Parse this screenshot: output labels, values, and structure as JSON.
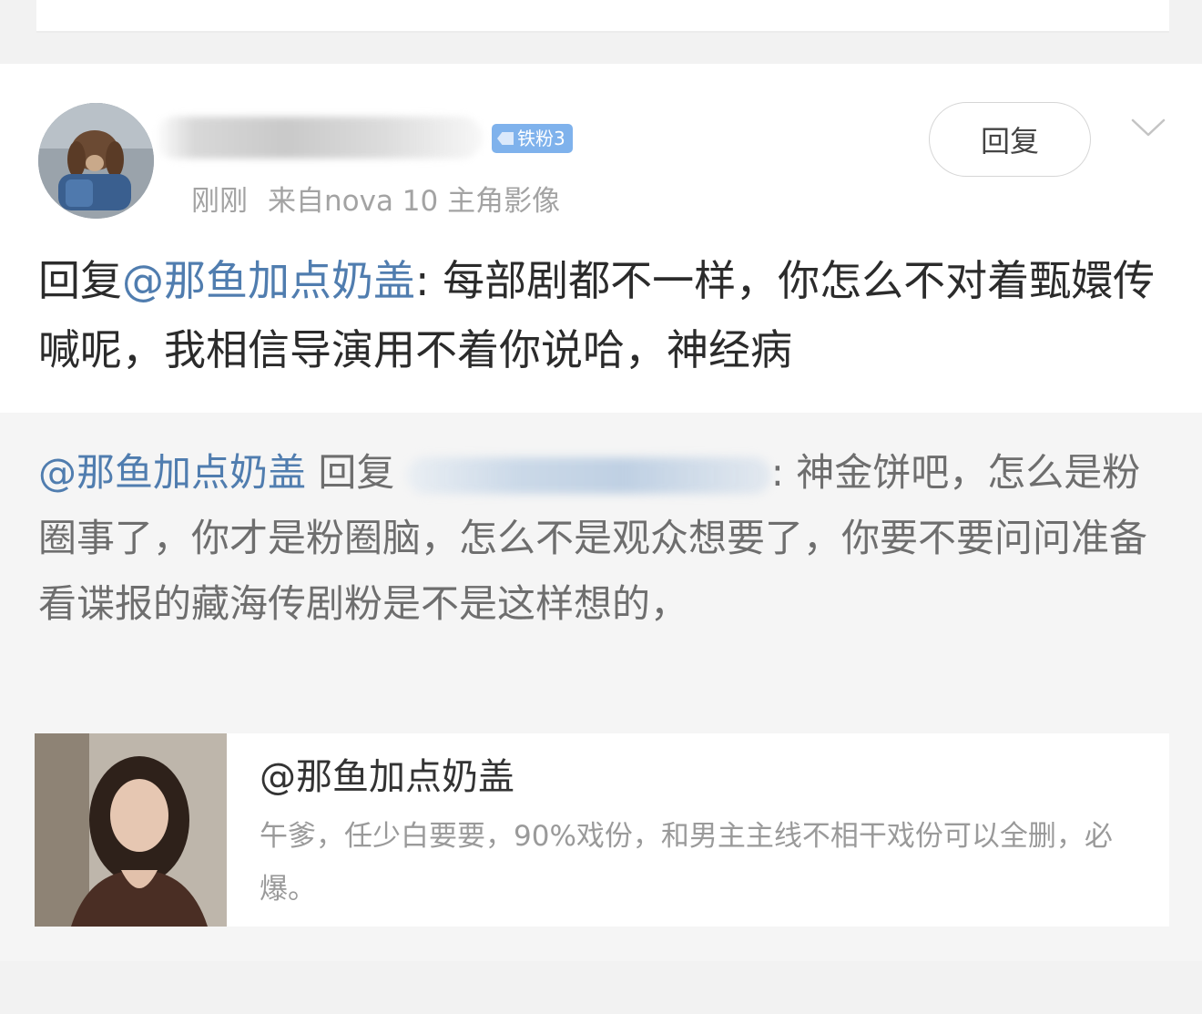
{
  "badge": {
    "label": "铁粉3"
  },
  "meta": {
    "time": "刚刚",
    "source": "来自nova 10 主角影像"
  },
  "actions": {
    "reply_label": "回复"
  },
  "comment": {
    "prefix": "回复",
    "mention": "@那鱼加点奶盖",
    "text": ": 每部剧都不一样，你怎么不对着甄嬛传喊呢，我相信导演用不着你说哈，神经病"
  },
  "quote": {
    "mention": "@那鱼加点奶盖",
    "reply_word": "回复",
    "text": ": 神金饼吧，怎么是粉圈事了，你才是粉圈脑，怎么不是观众想要了，你要不要问问准备看谍报的藏海传剧粉是不是这样想的，"
  },
  "share_card": {
    "title": "@那鱼加点奶盖",
    "description": "午爹，任少白要要，90%戏份，和男主主线不相干戏份可以全删，必爆。"
  }
}
